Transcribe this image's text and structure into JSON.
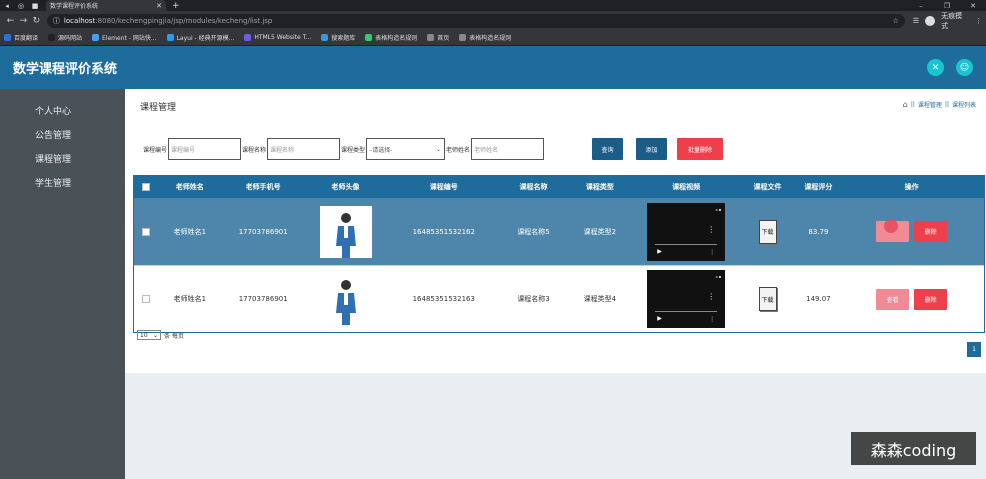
{
  "browser": {
    "tab_title": "数学课程评价系统",
    "url_host": "localhost",
    "url_path": ":8080/kechengpingjia/jsp/modules/kecheng/list.jsp",
    "incognito_label": "无痕模式",
    "bookmarks": [
      {
        "label": "百度翻译",
        "color": "#2a6fdb"
      },
      {
        "label": "源码网站",
        "color": "#222"
      },
      {
        "label": "Element - 网站快...",
        "color": "#409eff"
      },
      {
        "label": "Layui - 经典开源模...",
        "color": "#1e9fff"
      },
      {
        "label": "HTML5 Website T...",
        "color": "#6c5ce7"
      },
      {
        "label": "搜索题库",
        "color": "#3498db"
      },
      {
        "label": "表格构造名规则",
        "color": "#2ecc71"
      },
      {
        "label": "首页",
        "color": "#888"
      },
      {
        "label": "表格构造名规则",
        "color": "#888"
      }
    ]
  },
  "app": {
    "title": "数学课程评价系统"
  },
  "sidebar": {
    "items": [
      {
        "label": "个人中心"
      },
      {
        "label": "公告管理"
      },
      {
        "label": "课程管理"
      },
      {
        "label": "学生管理"
      }
    ]
  },
  "page": {
    "heading": "课程管理",
    "breadcrumb": [
      "课程管理",
      "课程列表"
    ],
    "breadcrumb_sep": "||"
  },
  "filters": {
    "course_number_label": "课程编号",
    "course_number_placeholder": "课程编号",
    "course_name_label": "课程名称",
    "course_name_placeholder": "课程名称",
    "course_type_label": "课程类型",
    "course_type_selected": "-请选择-",
    "teacher_name_label": "老师姓名",
    "teacher_name_placeholder": "老师姓名"
  },
  "buttons": {
    "query": "查询",
    "add": "添加",
    "batch_delete": "批量删除"
  },
  "table": {
    "headers": [
      "老师姓名",
      "老师手机号",
      "老师头像",
      "课程编号",
      "课程名称",
      "课程类型",
      "课程视频",
      "课程文件",
      "课程评分",
      "操作"
    ],
    "rows": [
      {
        "teacher_name": "老师姓名1",
        "phone": "17703786901",
        "course_number": "16485351532162",
        "course_name": "课程名称5",
        "course_type": "课程类型2",
        "download": "下载",
        "score": "83.79",
        "view": "查看",
        "delete": "删除"
      },
      {
        "teacher_name": "老师姓名1",
        "phone": "17703786901",
        "course_number": "16485351532163",
        "course_name": "课程名称3",
        "course_type": "课程类型4",
        "download": "下载",
        "score": "149.07",
        "view": "查看",
        "delete": "删除"
      }
    ]
  },
  "pagination": {
    "page_size": "10",
    "per_page_label": "条 每页",
    "current_page": "1"
  },
  "watermark": "森森coding"
}
